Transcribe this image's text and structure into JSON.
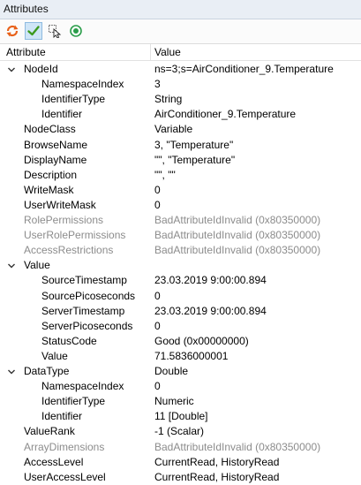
{
  "panel": {
    "title": "Attributes"
  },
  "toolbar": {
    "buttons": [
      {
        "icon": "refresh-icon"
      },
      {
        "icon": "check-icon",
        "active": true
      },
      {
        "icon": "select-cursor-icon"
      },
      {
        "icon": "record-icon"
      }
    ]
  },
  "table": {
    "headers": {
      "attribute": "Attribute",
      "value": "Value"
    },
    "rows": [
      {
        "name": "NodeId",
        "value": "ns=3;s=AirConditioner_9.Temperature",
        "level": 0,
        "expander": "expanded",
        "dim": false
      },
      {
        "name": "NamespaceIndex",
        "value": "3",
        "level": 1,
        "dim": false
      },
      {
        "name": "IdentifierType",
        "value": "String",
        "level": 1,
        "dim": false
      },
      {
        "name": "Identifier",
        "value": "AirConditioner_9.Temperature",
        "level": 1,
        "dim": false
      },
      {
        "name": "NodeClass",
        "value": "Variable",
        "level": 0,
        "dim": false
      },
      {
        "name": "BrowseName",
        "value": "3, \"Temperature\"",
        "level": 0,
        "dim": false
      },
      {
        "name": "DisplayName",
        "value": "\"\", \"Temperature\"",
        "level": 0,
        "dim": false
      },
      {
        "name": "Description",
        "value": "\"\", \"\"",
        "level": 0,
        "dim": false
      },
      {
        "name": "WriteMask",
        "value": "0",
        "level": 0,
        "dim": false
      },
      {
        "name": "UserWriteMask",
        "value": "0",
        "level": 0,
        "dim": false
      },
      {
        "name": "RolePermissions",
        "value": "BadAttributeIdInvalid (0x80350000)",
        "level": 0,
        "dim": true
      },
      {
        "name": "UserRolePermissions",
        "value": "BadAttributeIdInvalid (0x80350000)",
        "level": 0,
        "dim": true
      },
      {
        "name": "AccessRestrictions",
        "value": "BadAttributeIdInvalid (0x80350000)",
        "level": 0,
        "dim": true
      },
      {
        "name": "Value",
        "value": "",
        "level": 0,
        "expander": "expanded",
        "dim": false
      },
      {
        "name": "SourceTimestamp",
        "value": "23.03.2019 9:00:00.894",
        "level": 1,
        "dim": false
      },
      {
        "name": "SourcePicoseconds",
        "value": "0",
        "level": 1,
        "dim": false
      },
      {
        "name": "ServerTimestamp",
        "value": "23.03.2019 9:00:00.894",
        "level": 1,
        "dim": false
      },
      {
        "name": "ServerPicoseconds",
        "value": "0",
        "level": 1,
        "dim": false
      },
      {
        "name": "StatusCode",
        "value": "Good (0x00000000)",
        "level": 1,
        "dim": false
      },
      {
        "name": "Value",
        "value": "71.5836000001",
        "level": 1,
        "dim": false
      },
      {
        "name": "DataType",
        "value": "Double",
        "level": 0,
        "expander": "expanded",
        "dim": false
      },
      {
        "name": "NamespaceIndex",
        "value": "0",
        "level": 1,
        "dim": false
      },
      {
        "name": "IdentifierType",
        "value": "Numeric",
        "level": 1,
        "dim": false
      },
      {
        "name": "Identifier",
        "value": "11 [Double]",
        "level": 1,
        "dim": false
      },
      {
        "name": "ValueRank",
        "value": "-1 (Scalar)",
        "level": 0,
        "dim": false
      },
      {
        "name": "ArrayDimensions",
        "value": "BadAttributeIdInvalid (0x80350000)",
        "level": 0,
        "dim": true
      },
      {
        "name": "AccessLevel",
        "value": "CurrentRead, HistoryRead",
        "level": 0,
        "dim": false
      },
      {
        "name": "UserAccessLevel",
        "value": "CurrentRead, HistoryRead",
        "level": 0,
        "dim": false
      }
    ]
  }
}
